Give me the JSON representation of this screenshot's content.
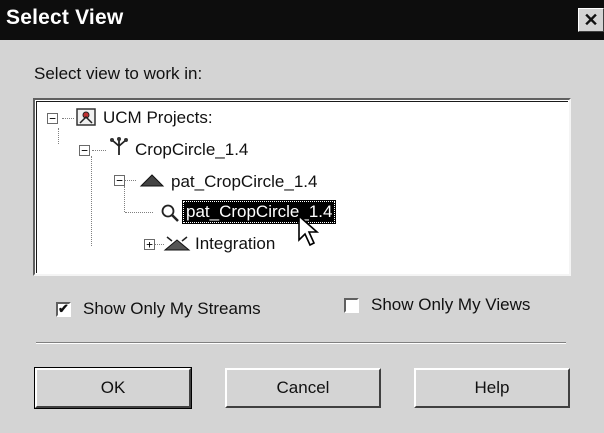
{
  "window": {
    "title": "Select View",
    "close_label": "✕"
  },
  "prompt": "Select view to work in:",
  "tree": {
    "root": {
      "label": "UCM Projects:",
      "icon": "ucm-projects-icon",
      "expander": "−"
    },
    "project": {
      "label": "CropCircle_1.4",
      "icon": "project-icon",
      "expander": "−"
    },
    "stream": {
      "label": "pat_CropCircle_1.4",
      "icon": "stream-icon",
      "expander": "−"
    },
    "view": {
      "label": "pat_CropCircle_1.4",
      "icon": "view-icon",
      "selected": true
    },
    "integration": {
      "label": "Integration",
      "icon": "integration-stream-icon",
      "expander": "+"
    }
  },
  "options": {
    "show_my_streams": {
      "label": "Show Only My Streams",
      "checked": true,
      "mark": "✔"
    },
    "show_my_views": {
      "label": "Show Only My Views",
      "checked": false,
      "mark": ""
    }
  },
  "buttons": {
    "ok": "OK",
    "cancel": "Cancel",
    "help": "Help"
  },
  "colors": {
    "titlebar": "#0d0d0d",
    "dialog_bg": "#d4d4d4",
    "selection_bg": "#000000"
  }
}
